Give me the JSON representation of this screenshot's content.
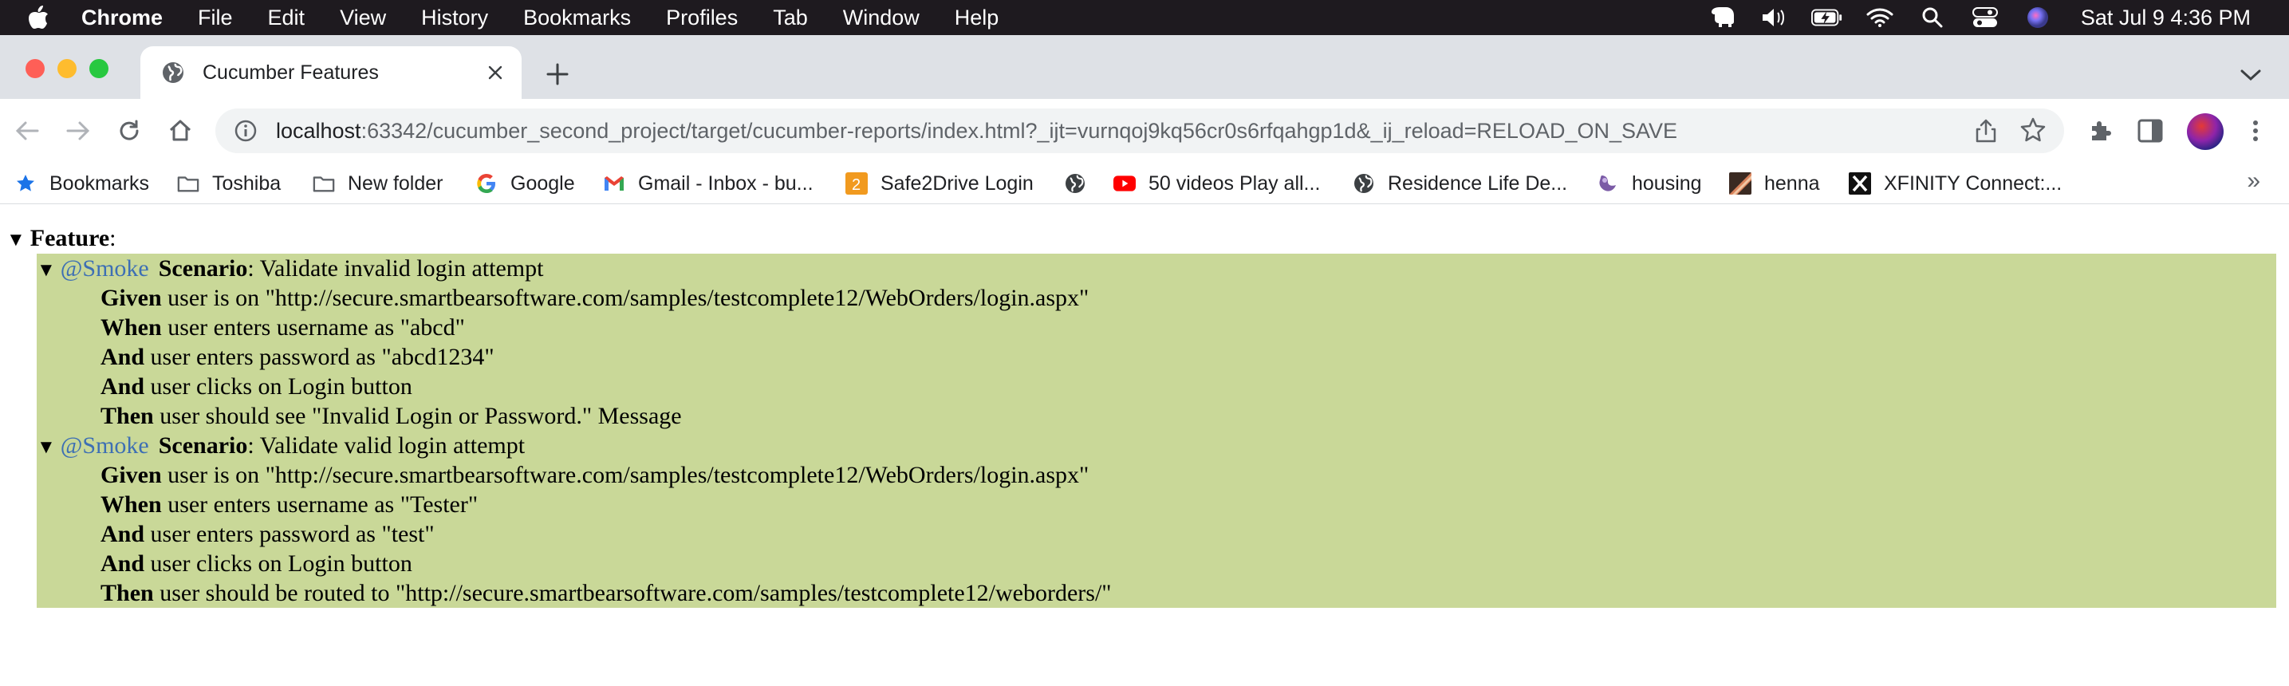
{
  "menubar": {
    "app": "Chrome",
    "items": [
      "File",
      "Edit",
      "View",
      "History",
      "Bookmarks",
      "Profiles",
      "Tab",
      "Window",
      "Help"
    ],
    "clock": "Sat Jul 9  4:36 PM"
  },
  "tab": {
    "title": "Cucumber Features"
  },
  "omnibox": {
    "host": "localhost",
    "rest": ":63342/cucumber_second_project/target/cucumber-reports/index.html?_ijt=vurnqoj9kq56cr0s6rfqahgp1d&_ij_reload=RELOAD_ON_SAVE"
  },
  "bookmarks": [
    {
      "label": "Bookmarks",
      "icon": "star-icon"
    },
    {
      "label": "Toshiba",
      "icon": "folder-icon"
    },
    {
      "label": "New folder",
      "icon": "folder-icon"
    },
    {
      "label": "Google",
      "icon": "google-icon"
    },
    {
      "label": "Gmail - Inbox - bu...",
      "icon": "gmail-icon"
    },
    {
      "label": "Safe2Drive Login",
      "icon": "safe2drive-icon"
    },
    {
      "label": "",
      "icon": "globe-icon"
    },
    {
      "label": "50 videos Play all...",
      "icon": "youtube-icon"
    },
    {
      "label": "Residence Life De...",
      "icon": "globe-icon"
    },
    {
      "label": "housing",
      "icon": "housing-icon"
    },
    {
      "label": "henna",
      "icon": "henna-icon"
    },
    {
      "label": "XFINITY Connect:...",
      "icon": "xfinity-icon"
    }
  ],
  "report": {
    "feature_label": "Feature",
    "feature_suffix": ":",
    "scenarios": [
      {
        "tag": "@Smoke",
        "keyword": "Scenario",
        "title": ": Validate invalid login attempt",
        "steps": [
          {
            "keyword": "Given",
            "text": " user is on \"http://secure.smartbearsoftware.com/samples/testcomplete12/WebOrders/login.aspx\""
          },
          {
            "keyword": "When",
            "text": " user enters username as \"abcd\""
          },
          {
            "keyword": "And",
            "text": " user enters password as \"abcd1234\""
          },
          {
            "keyword": "And",
            "text": " user clicks on Login button"
          },
          {
            "keyword": "Then",
            "text": " user should see \"Invalid Login or Password.\" Message"
          }
        ]
      },
      {
        "tag": "@Smoke",
        "keyword": "Scenario",
        "title": ": Validate valid login attempt",
        "steps": [
          {
            "keyword": "Given",
            "text": " user is on \"http://secure.smartbearsoftware.com/samples/testcomplete12/WebOrders/login.aspx\""
          },
          {
            "keyword": "When",
            "text": " user enters username as \"Tester\""
          },
          {
            "keyword": "And",
            "text": " user enters password as \"test\""
          },
          {
            "keyword": "And",
            "text": " user clicks on Login button"
          },
          {
            "keyword": "Then",
            "text": " user should be routed to \"http://secure.smartbearsoftware.com/samples/testcomplete12/weborders/\""
          }
        ]
      }
    ]
  },
  "colors": {
    "scenario_passed": "#c9d898",
    "tag": "#3d6fb4"
  }
}
